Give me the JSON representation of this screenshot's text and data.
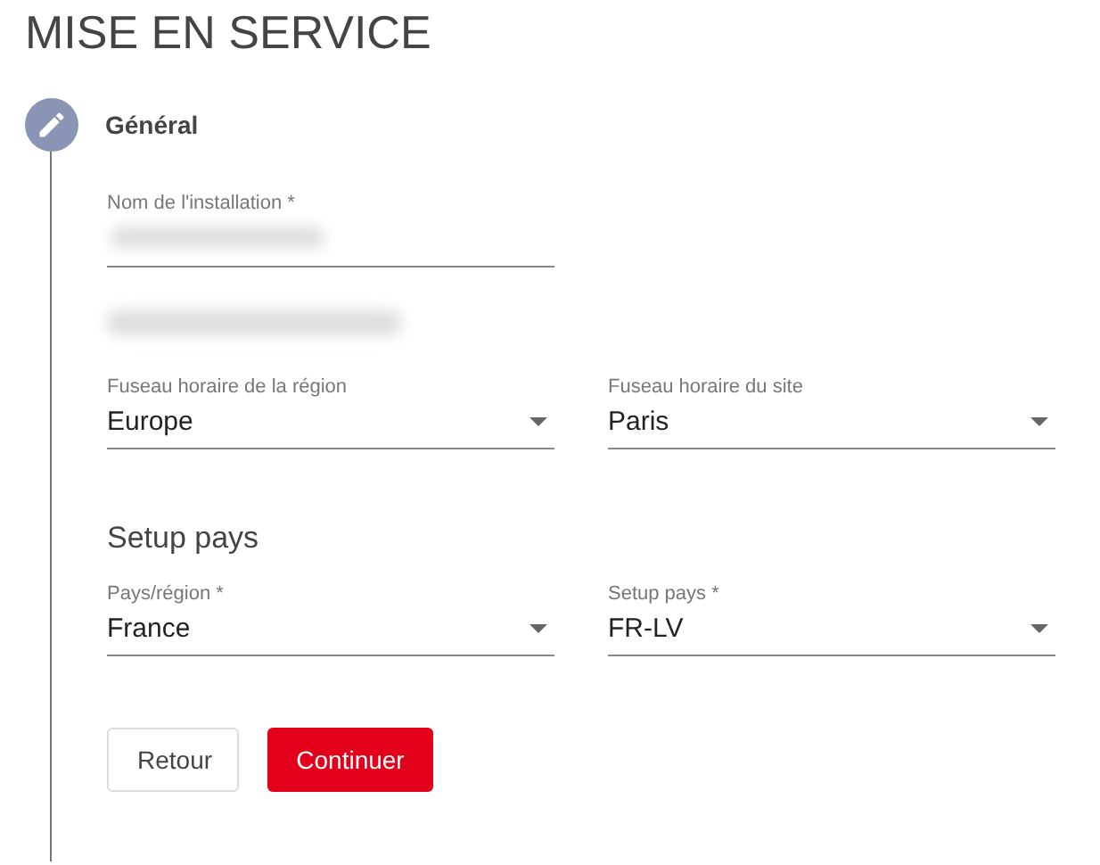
{
  "page_title": "MISE EN SERVICE",
  "steps": [
    {
      "title": "Général",
      "editing": true,
      "name_field": {
        "label": "Nom de l'installation *",
        "value_obscured": true
      },
      "note_obscured": true,
      "rows": [
        [
          {
            "label": "Fuseau horaire de la région",
            "value": "Europe"
          },
          {
            "label": "Fuseau horaire du site",
            "value": "Paris"
          }
        ],
        {
          "heading": "Setup pays"
        },
        [
          {
            "label": "Pays/région *",
            "value": "France"
          },
          {
            "label": "Setup pays *",
            "value": "FR-LV"
          }
        ]
      ],
      "buttons": [
        {
          "label": "Retour",
          "kind": "secondary"
        },
        {
          "label": "Continuer",
          "kind": "primary"
        }
      ]
    }
  ]
}
